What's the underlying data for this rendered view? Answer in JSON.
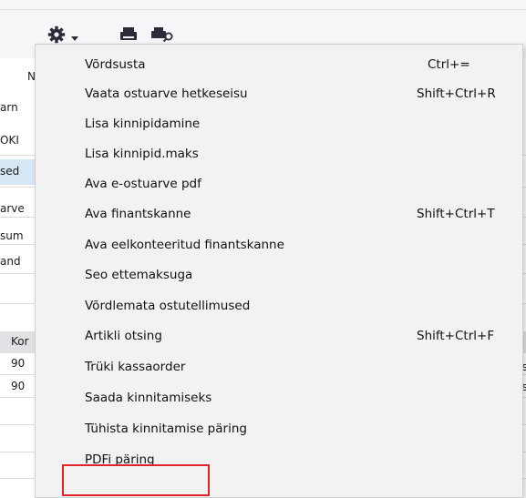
{
  "toolbar": {
    "icons": [
      "gear-icon",
      "chevron-down-icon",
      "printer-icon",
      "print-preview-icon"
    ],
    "colors": {
      "icon": "#2b2b3a",
      "background": "#f5f6f8"
    }
  },
  "background_fragments": {
    "labels": [
      "N",
      "arn",
      "OKI",
      "sed",
      "arve",
      "sum",
      "and",
      "Kor"
    ],
    "rows": [
      {
        "num": "90",
        "right": "us"
      },
      {
        "num": "90",
        "right": "us"
      }
    ]
  },
  "menu": {
    "items": [
      {
        "label": "Võrdsusta",
        "shortcut": "Ctrl+="
      },
      {
        "label": "Vaata ostuarve hetkeseisu",
        "shortcut": "Shift+Ctrl+R"
      },
      {
        "label": "Lisa kinnipidamine",
        "shortcut": ""
      },
      {
        "label": "Lisa kinnipid.maks",
        "shortcut": ""
      },
      {
        "label": "Ava e-ostuarve pdf",
        "shortcut": ""
      },
      {
        "label": "Ava finantskanne",
        "shortcut": "Shift+Ctrl+T"
      },
      {
        "label": "Ava eelkonteeritud finantskanne",
        "shortcut": ""
      },
      {
        "label": "Seo ettemaksuga",
        "shortcut": ""
      },
      {
        "label": "Võrdlemata ostutellimused",
        "shortcut": ""
      },
      {
        "label": "Artikli otsing",
        "shortcut": "Shift+Ctrl+F"
      },
      {
        "label": "Trüki kassaorder",
        "shortcut": ""
      },
      {
        "label": "Saada kinnitamiseks",
        "shortcut": ""
      },
      {
        "label": "Tühista kinnitamise päring",
        "shortcut": ""
      },
      {
        "label": "PDFi päring",
        "shortcut": ""
      }
    ],
    "highlight_color": "#e0242c"
  }
}
